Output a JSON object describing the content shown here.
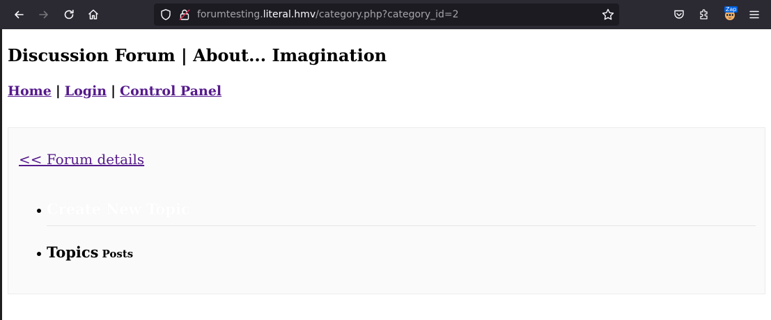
{
  "browser": {
    "url_prefix": "forumtesting.",
    "url_host": "literal.hmv",
    "url_path": "/category.php?category_id=2",
    "extension_badge": "Zap"
  },
  "page": {
    "title": "Discussion Forum | About... Imagination",
    "nav": {
      "home": "Home",
      "login": "Login",
      "control_panel": "Control Panel",
      "separator": "|"
    },
    "back_link": "<< Forum details",
    "create_topic": "Create New Topic",
    "topics_label": "Topics",
    "posts_label": "Posts"
  },
  "colors": {
    "toolbar_bg": "#2b2a33",
    "urlbar_bg": "#1c1b22",
    "link_visited": "#551a8b",
    "content_box_bg": "#fafafa"
  }
}
